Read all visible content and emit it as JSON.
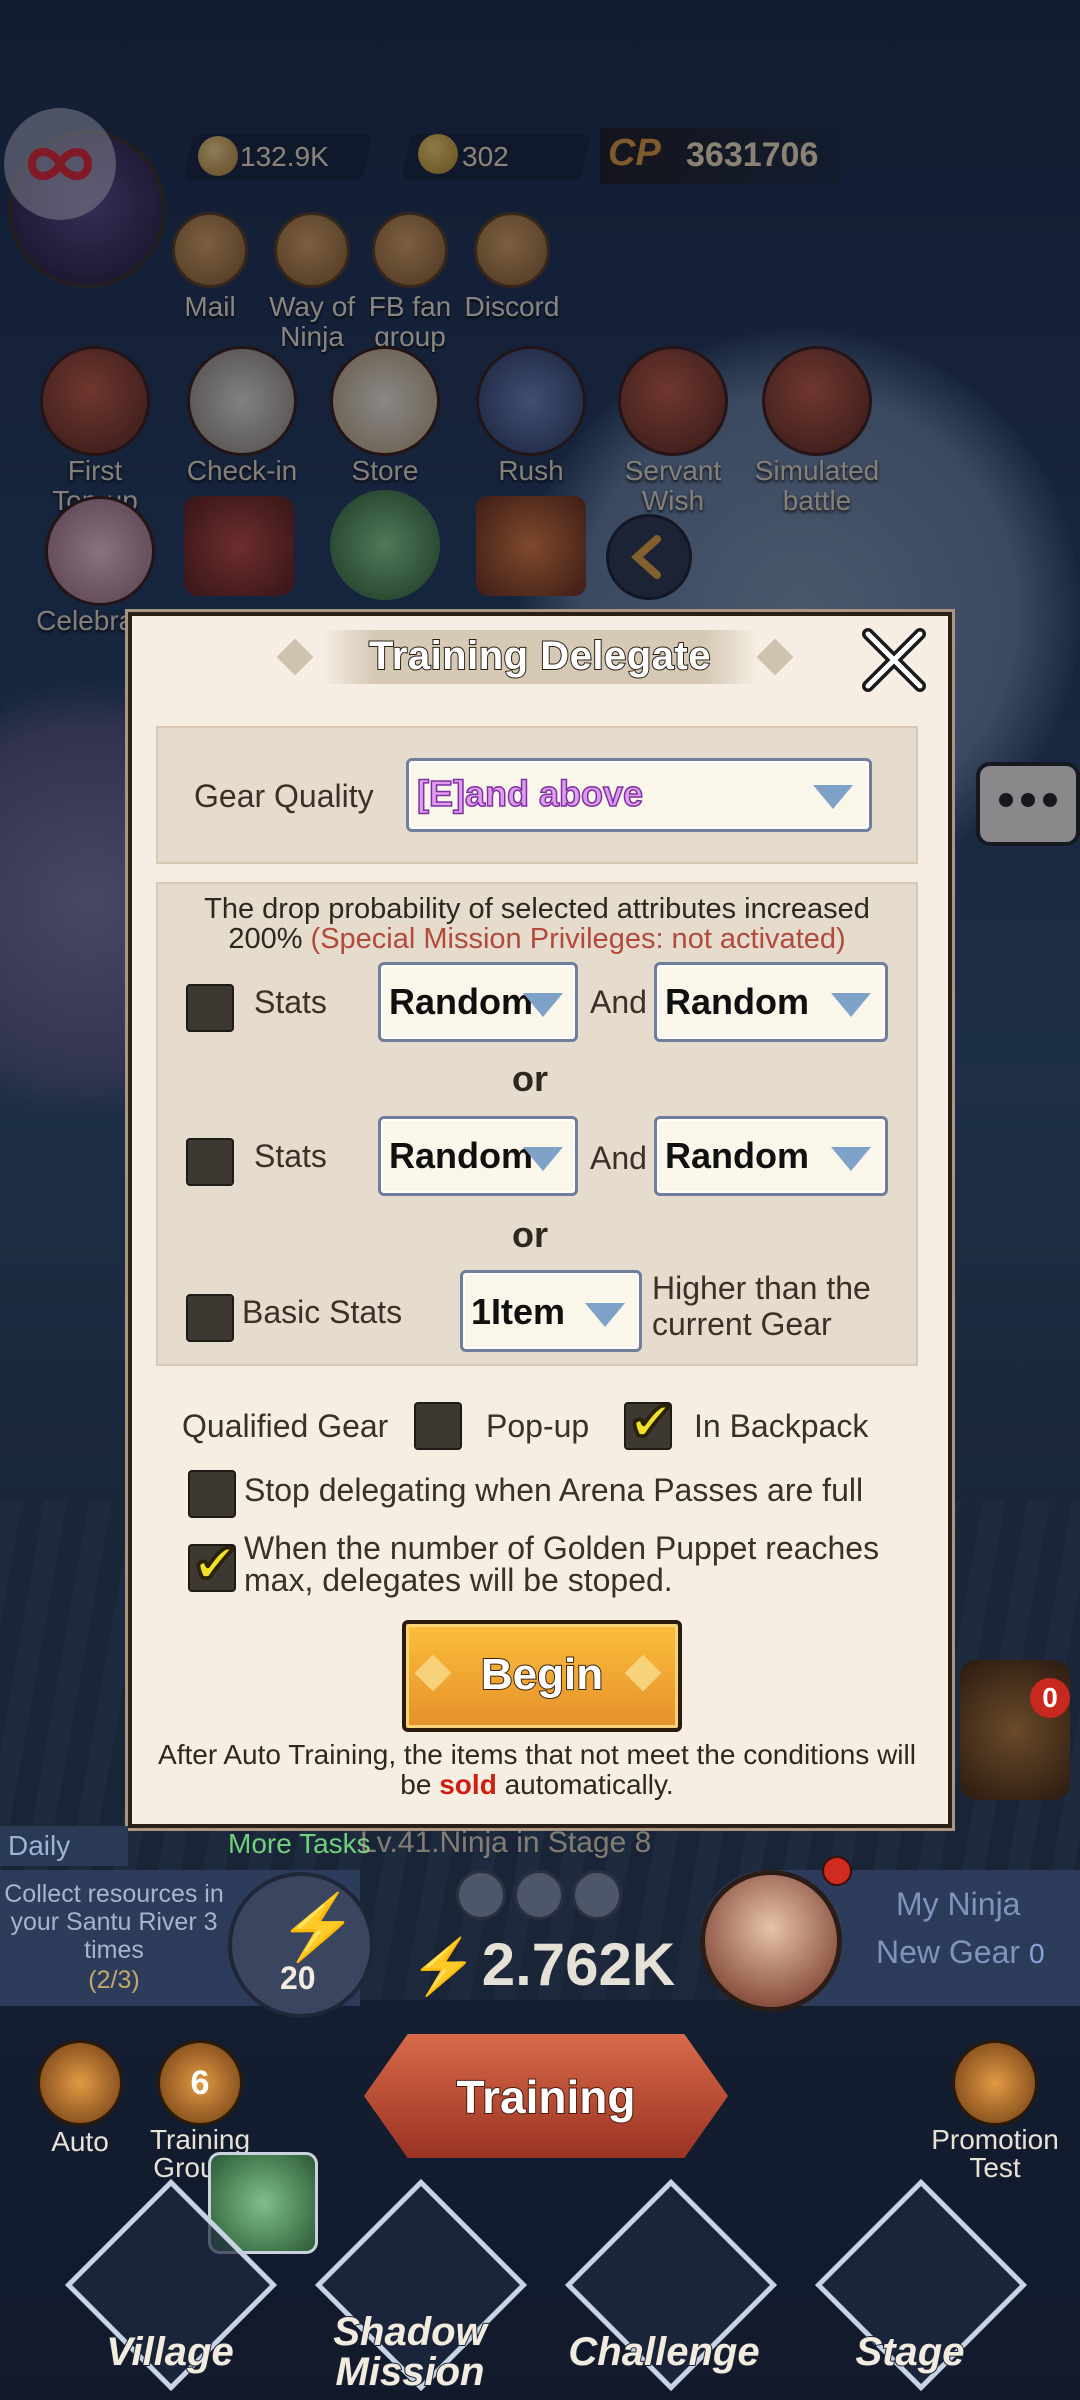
{
  "top": {
    "copper": "132.9K",
    "ingots": "302",
    "cp_label": "CP",
    "cp_value": "3631706"
  },
  "top_icons": [
    {
      "label": "Mail"
    },
    {
      "label": "Way of Ninja"
    },
    {
      "label": "FB fan group"
    },
    {
      "label": "Discord"
    }
  ],
  "features_row1": [
    {
      "label": "First Top-up"
    },
    {
      "label": "Check-in"
    },
    {
      "label": "Store"
    },
    {
      "label": "Rush"
    },
    {
      "label": "Servant Wish"
    },
    {
      "label": "Simulated battle"
    }
  ],
  "features_row2": [
    {
      "label": "Celebratio"
    }
  ],
  "modal": {
    "title": "Training Delegate",
    "gear_quality_label": "Gear Quality",
    "gear_quality_value": "[E]and above",
    "prob_text": "The drop probability of selected attributes increased 200%",
    "privilege_text": "(Special Mission Privileges: not activated)",
    "row1_label": "Stats",
    "row1_a": "Random",
    "row1_and": "And",
    "row1_b": "Random",
    "or1": "or",
    "row2_label": "Stats",
    "row2_a": "Random",
    "row2_and": "And",
    "row2_b": "Random",
    "or2": "or",
    "basic_label": "Basic Stats",
    "basic_value": "1Item",
    "basic_suffix": "Higher than the current Gear",
    "qualified_label": "Qualified Gear",
    "popup_label": "Pop-up",
    "backpack_label": "In Backpack",
    "backpack_checked": true,
    "arena_label": "Stop delegating when Arena Passes are full",
    "puppet_label": "When the number of Golden Puppet reaches max, delegates will be stoped.",
    "puppet_checked": true,
    "begin_label": "Begin",
    "footer_1": "After Auto Training, the items that not meet the conditions will be",
    "footer_sold": "sold",
    "footer_2": "automatically."
  },
  "hud": {
    "daily_label": "Daily",
    "more_tasks": "More Tasks",
    "stage_text": "Lv.41.Ninja in Stage 8",
    "task_text": "Collect resources in your Santu River 3 times",
    "task_progress": "(2/3)",
    "energy_badge": "20",
    "energy_total": "2.762K",
    "my_ninja": "My Ninja",
    "new_gear": "New Gear",
    "new_gear_count": "0",
    "badge_zero": "0",
    "auto_label": "Auto",
    "training_ground_num": "6",
    "training_ground_label": "Training Ground",
    "training_label": "Training",
    "promotion_label": "Promotion Test",
    "nav": [
      "Village",
      "Shadow Mission",
      "Challenge",
      "Stage"
    ]
  }
}
